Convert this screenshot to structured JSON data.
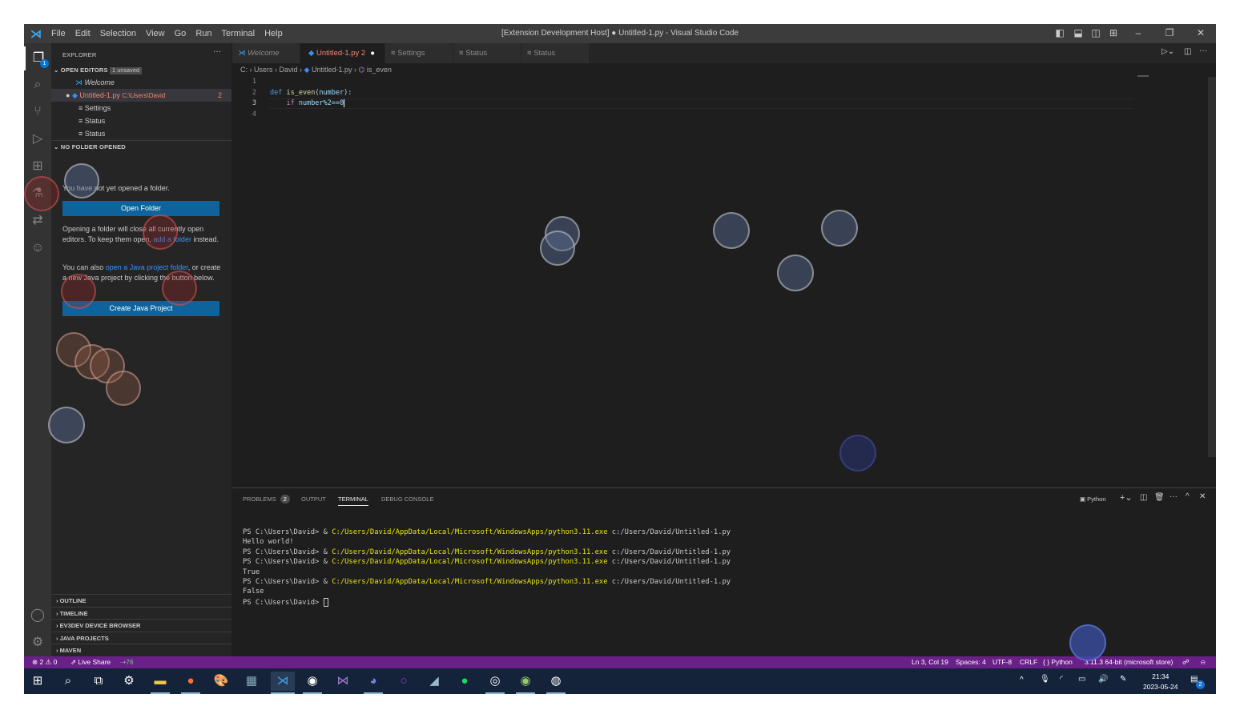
{
  "window": {
    "title": "[Extension Development Host] ● Untitled-1.py - Visual Studio Code"
  },
  "menu": [
    "File",
    "Edit",
    "Selection",
    "View",
    "Go",
    "Run",
    "Terminal",
    "Help"
  ],
  "activity": {
    "explorer_badge": "1"
  },
  "sidebar": {
    "title": "EXPLORER",
    "open_editors": {
      "label": "OPEN EDITORS",
      "badge": "1 unsaved",
      "items": [
        {
          "label": "Welcome"
        },
        {
          "label": "Untitled-1.py",
          "path": "C:\\Users\\David",
          "problems": "2"
        },
        {
          "label": "Settings"
        },
        {
          "label": "Status"
        },
        {
          "label": "Status"
        }
      ]
    },
    "no_folder": {
      "label": "NO FOLDER OPENED",
      "text1": "You have not yet opened a folder.",
      "open_folder": "Open Folder",
      "text2a": "Opening a folder will close all currently open editors. To keep them open, ",
      "text2link": "add a folder",
      "text2b": " instead.",
      "text3a": "You can also ",
      "text3link": "open a Java project folder",
      "text3b": ", or create a new Java project by clicking the button below.",
      "create_java": "Create Java Project"
    },
    "sections": [
      "OUTLINE",
      "TIMELINE",
      "EV3DEV DEVICE BROWSER",
      "JAVA PROJECTS",
      "MAVEN"
    ]
  },
  "editor": {
    "tabs": [
      {
        "label": "Welcome"
      },
      {
        "label": "Untitled-1.py 2"
      },
      {
        "label": "Settings"
      },
      {
        "label": "Status"
      },
      {
        "label": "Status"
      }
    ],
    "breadcrumb": [
      "C:",
      "Users",
      "David",
      "Untitled-1.py",
      "is_even"
    ],
    "lines": [
      {
        "n": "1",
        "t": ""
      },
      {
        "n": "2",
        "kw": "def",
        "fn": "is_even",
        "rest": "(number):"
      },
      {
        "n": "3",
        "kw": "    if",
        "rest": " number%2==0"
      },
      {
        "n": "4",
        "t": ""
      }
    ]
  },
  "panel": {
    "tabs": [
      "PROBLEMS",
      "OUTPUT",
      "TERMINAL",
      "DEBUG CONSOLE"
    ],
    "problems_count": "2",
    "shell": "Python",
    "terminal": [
      {
        "p": "PS C:\\Users\\David> & ",
        "c": "C:/Users/David/AppData/Local/Microsoft/WindowsApps/python3.11.exe",
        "a": " c:/Users/David/Untitled-1.py"
      },
      {
        "o": "Hello world!"
      },
      {
        "p": "PS C:\\Users\\David> & ",
        "c": "C:/Users/David/AppData/Local/Microsoft/WindowsApps/python3.11.exe",
        "a": " c:/Users/David/Untitled-1.py"
      },
      {
        "p": "PS C:\\Users\\David> & ",
        "c": "C:/Users/David/AppData/Local/Microsoft/WindowsApps/python3.11.exe",
        "a": " c:/Users/David/Untitled-1.py"
      },
      {
        "o": "True"
      },
      {
        "p": "PS C:\\Users\\David> & ",
        "c": "C:/Users/David/AppData/Local/Microsoft/WindowsApps/python3.11.exe",
        "a": " c:/Users/David/Untitled-1.py"
      },
      {
        "o": "False"
      },
      {
        "o": "PS C:\\Users\\David> "
      }
    ]
  },
  "status": {
    "errors": "2",
    "warnings": "0",
    "live_share": "Live Share",
    "ports": "76",
    "position": "Ln 3, Col 19",
    "spaces": "Spaces: 4",
    "encoding": "UTF-8",
    "eol": "CRLF",
    "language": "Python",
    "interpreter": "3.11.3 64-bit (microsoft store)"
  },
  "taskbar": {
    "time": "21:34",
    "date": "2023-05-24",
    "notifications": "2"
  },
  "colors": {
    "status_bar": "#6b1f88",
    "accent": "#0e639c",
    "error_text": "#f48771"
  }
}
